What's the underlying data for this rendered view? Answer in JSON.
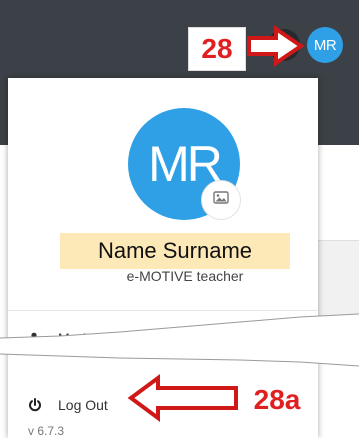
{
  "header": {
    "avatar_initials": "MR"
  },
  "callouts": {
    "step_main": "28",
    "step_sub": "28a"
  },
  "profile": {
    "avatar_initials": "MR",
    "name": "Name Surname",
    "role": "e-MOTIVE teacher",
    "photo_icon": "image-icon"
  },
  "menu": {
    "items": [
      {
        "label": "My Account",
        "icon": "user-icon"
      },
      {
        "label": "Log Out",
        "icon": "power-icon"
      }
    ],
    "version": "v 6.7.3"
  },
  "colors": {
    "accent": "#2f9fe6",
    "callout": "#e02020",
    "highlight": "#fde9b8",
    "topbar": "#3b4146"
  }
}
